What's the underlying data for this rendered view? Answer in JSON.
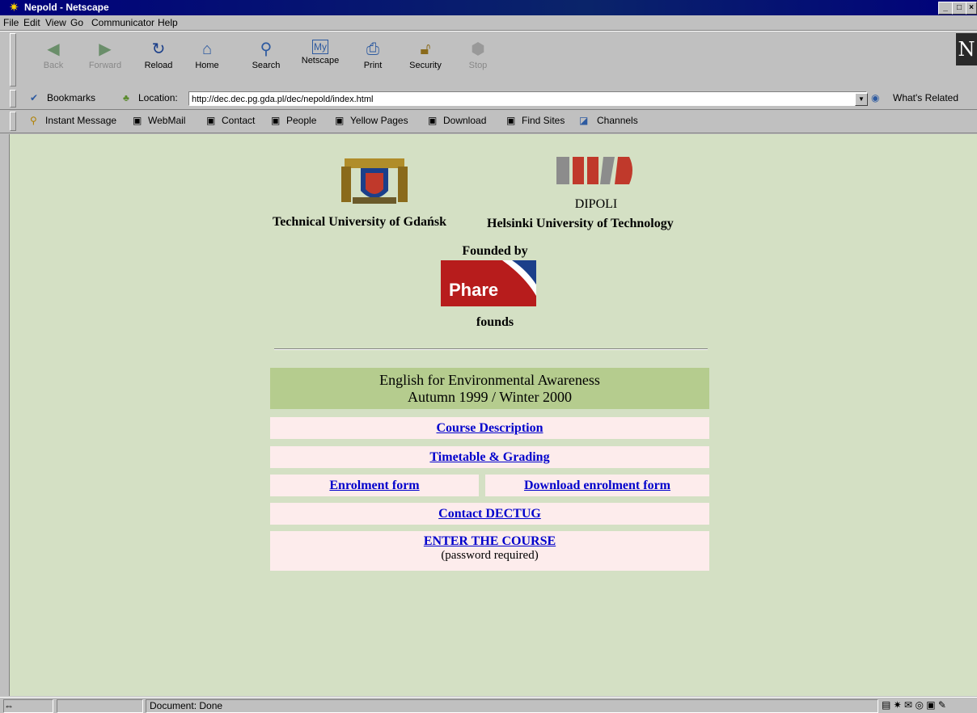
{
  "window": {
    "title": "Nepold - Netscape",
    "min": "_",
    "max": "□",
    "close": "×"
  },
  "menu": [
    "File",
    "Edit",
    "View",
    "Go",
    "Communicator",
    "Help"
  ],
  "toolbar": {
    "back": "Back",
    "forward": "Forward",
    "reload": "Reload",
    "home": "Home",
    "search": "Search",
    "netscape": "Netscape",
    "print": "Print",
    "security": "Security",
    "stop": "Stop"
  },
  "location": {
    "bookmarks": "Bookmarks",
    "label": "Location:",
    "url": "http://dec.dec.pg.gda.pl/dec/nepold/index.html",
    "whats_related": "What's Related"
  },
  "personal": [
    "Instant Message",
    "WebMail",
    "Contact",
    "People",
    "Yellow Pages",
    "Download",
    "Find Sites",
    "Channels"
  ],
  "page": {
    "tug_name": "Technical University of Gdańsk",
    "dipoli": "DIPOLI",
    "hut_name": "Helsinki University of Technology",
    "founded_by": "Founded by",
    "phare": "Phare",
    "founds": "founds",
    "course_title": "English for Environmental Awareness",
    "course_term": "Autumn 1999 / Winter 2000",
    "links": {
      "course_description": "Course Description",
      "timetable": "Timetable & Grading",
      "enrolment": "Enrolment form",
      "download_enrolment": "Download enrolment form ",
      "contact": "Contact DECTUG",
      "enter": "ENTER THE COURSE",
      "password_note": "(password required)"
    }
  },
  "status": {
    "text": "Document: Done"
  },
  "colors": {
    "page_bg": "#d4e0c4",
    "header_bg": "#b5cc8e",
    "link_bg": "#fdecec",
    "link": "#0000cc",
    "phare_red": "#b71c1c"
  }
}
